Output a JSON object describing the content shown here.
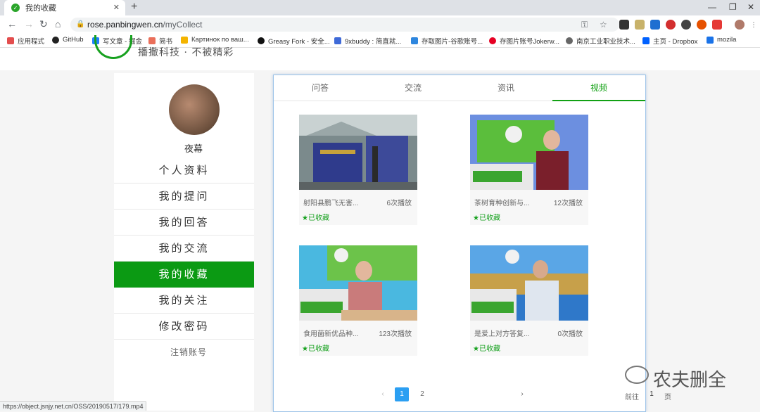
{
  "browser": {
    "tab_title": "我的收藏",
    "url_host": "rose.panbingwen.cn",
    "url_path": "/myCollect",
    "new_tab": "+",
    "close": "✕",
    "minimize": "—",
    "restore": "❐",
    "win_close": "✕"
  },
  "bookmarks": [
    {
      "label": "应用程式",
      "icon": "apps-icon"
    },
    {
      "label": "GitHub",
      "icon": "github-icon"
    },
    {
      "label": "写文章 - 掘金",
      "icon": "juejin-icon"
    },
    {
      "label": "简书",
      "icon": "jianshu-icon"
    },
    {
      "label": "Картинок по ваш...",
      "icon": "image-icon"
    },
    {
      "label": "Greasy Fork - 安全...",
      "icon": "greasyfork-icon"
    },
    {
      "label": "9xbuddy : 简直就...",
      "icon": "9xbuddy-icon"
    },
    {
      "label": "存取图片-谷歌账号...",
      "icon": "photo-icon"
    },
    {
      "label": "存图片账号Jokerw...",
      "icon": "pinterest-icon"
    },
    {
      "label": "南京工业职业技术...",
      "icon": "globe-icon"
    },
    {
      "label": "主页 - Dropbox",
      "icon": "dropbox-icon"
    },
    {
      "label": "mozila",
      "icon": "mozilla-icon"
    }
  ],
  "site": {
    "slogan": "播撒科技 · 不被精彩"
  },
  "sidebar": {
    "username": "夜幕",
    "items": [
      {
        "label": "个人资料"
      },
      {
        "label": "我的提问"
      },
      {
        "label": "我的回答"
      },
      {
        "label": "我的交流"
      },
      {
        "label": "我的收藏"
      },
      {
        "label": "我的关注"
      },
      {
        "label": "修改密码"
      }
    ],
    "logout": "注销账号"
  },
  "content": {
    "tabs": [
      {
        "label": "问答"
      },
      {
        "label": "交流"
      },
      {
        "label": "资讯"
      },
      {
        "label": "视频"
      }
    ],
    "videos": [
      {
        "title": "射阳县鹏飞无害...",
        "plays": "6次播放",
        "fav": "★已收藏"
      },
      {
        "title": "茶树育种创新与...",
        "plays": "12次播放",
        "fav": "★已收藏"
      },
      {
        "title": "食用菌新优品种...",
        "plays": "123次播放",
        "fav": "★已收藏"
      },
      {
        "title": "是爱上对方答复...",
        "plays": "0次播放",
        "fav": "★已收藏"
      }
    ],
    "pager": {
      "prev": "‹",
      "page1": "1",
      "page2": "2",
      "next": "›",
      "goto": "前往",
      "goto_value": "1",
      "page_unit": "页"
    }
  },
  "watermark": "农夫删全",
  "status_url": "https://object.jsnjy.net.cn/OSS/20190517/179.mp4",
  "colors": {
    "accent": "#0b9a13",
    "tab_active": "#12a114",
    "pager_current": "#2b9ff2"
  }
}
